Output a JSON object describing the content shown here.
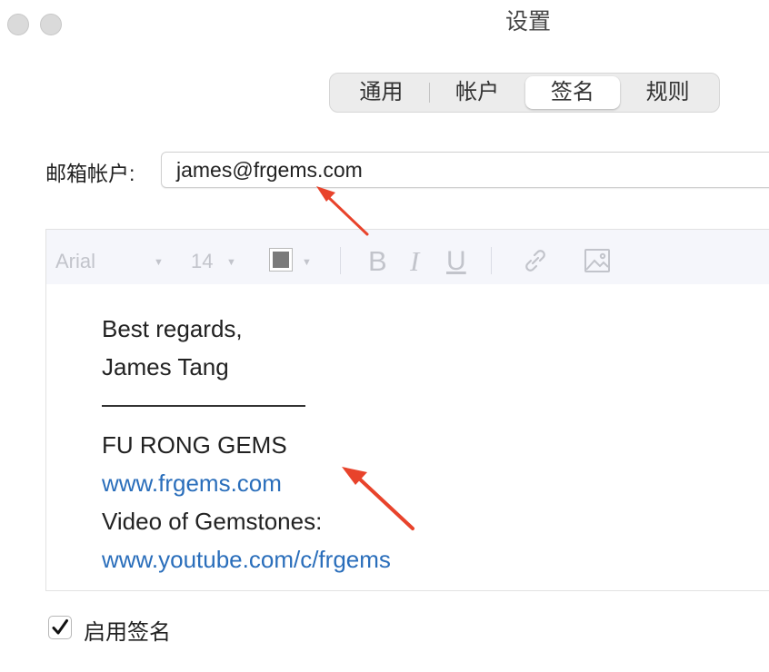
{
  "window": {
    "title": "设置"
  },
  "tabs": [
    {
      "label": "通用",
      "active": false
    },
    {
      "label": "帐户",
      "active": false
    },
    {
      "label": "签名",
      "active": true
    },
    {
      "label": "规则",
      "active": false
    }
  ],
  "account": {
    "label": "邮箱帐户:",
    "value": "james@frgems.com"
  },
  "toolbar": {
    "font": "Arial",
    "size": "14",
    "text_color": "#7a7a7a",
    "bold": "B",
    "italic": "I",
    "underline": "U"
  },
  "signature": {
    "line1": "Best regards,",
    "line2": "James Tang",
    "line3": "FU RONG GEMS",
    "link1": "www.frgems.com",
    "line4": "Video of Gemstones:",
    "link2": "www.youtube.com/c/frgems",
    "link_color": "#2a6ebb"
  },
  "enable_signature": {
    "label": "启用签名",
    "checked": true
  },
  "annotation_color": "#e8432b"
}
